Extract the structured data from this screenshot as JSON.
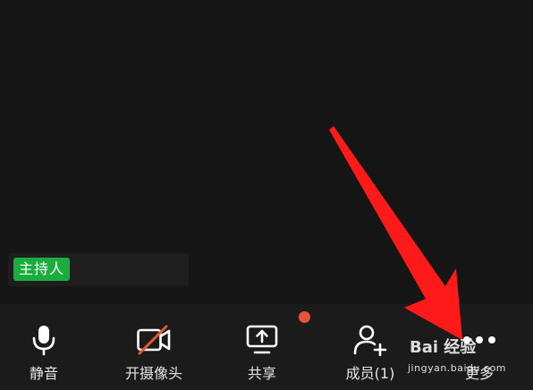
{
  "host": {
    "badge_label": "主持人"
  },
  "toolbar": {
    "items": [
      {
        "label": "静音",
        "icon": "microphone-icon"
      },
      {
        "label": "开摄像头",
        "icon": "camera-off-icon"
      },
      {
        "label": "共享",
        "icon": "share-screen-icon"
      },
      {
        "label": "成员(1)",
        "icon": "add-member-icon"
      },
      {
        "label": "更多",
        "icon": "more-dots-icon"
      }
    ]
  },
  "watermark": {
    "brand": "Bai  经验",
    "url": "jingyan.baidu.com"
  },
  "colors": {
    "background": "#141414",
    "toolbar": "#1b1b1b",
    "host_badge": "#1aad3e",
    "camera_slash": "#e8543a",
    "notify_dot": "#e8543a",
    "annotation_arrow": "#ff1a1a"
  }
}
